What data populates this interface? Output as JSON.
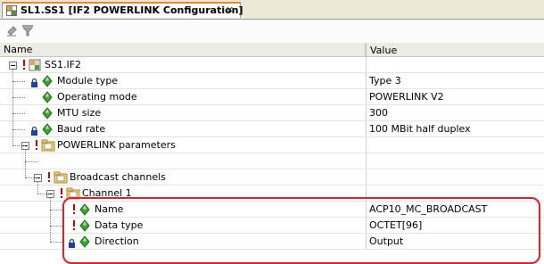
{
  "tab": {
    "title": "SL1.SS1 [IF2 POWERLINK Configuration]",
    "close_glyph": "×",
    "icon": "config-grid-icon"
  },
  "toolbar": {
    "buttons": [
      {
        "name": "edit-tool-button",
        "icon": "eraser-icon"
      },
      {
        "name": "filter-tool-button",
        "icon": "funnel-icon"
      }
    ]
  },
  "grid": {
    "headers": {
      "name": "Name",
      "value": "Value"
    },
    "rows": [
      {
        "label": "SS1.IF2",
        "value": "",
        "icon": "module-folder-icon",
        "expander": "minus",
        "warning": true,
        "lock": false,
        "depth": 0
      },
      {
        "label": "Module type",
        "value": "Type 3",
        "icon": "green-diamond-icon",
        "expander": "",
        "warning": false,
        "lock": true,
        "depth": 1
      },
      {
        "label": "Operating mode",
        "value": "POWERLINK V2",
        "icon": "green-diamond-icon",
        "expander": "",
        "warning": false,
        "lock": false,
        "depth": 1
      },
      {
        "label": "MTU size",
        "value": "300",
        "icon": "green-diamond-icon",
        "expander": "",
        "warning": false,
        "lock": false,
        "depth": 1
      },
      {
        "label": "Baud rate",
        "value": "100 MBit half duplex",
        "icon": "green-diamond-icon",
        "expander": "",
        "warning": false,
        "lock": true,
        "depth": 1
      },
      {
        "label": "POWERLINK parameters",
        "value": "",
        "icon": "folder-icon",
        "expander": "minus",
        "warning": true,
        "lock": false,
        "depth": 1
      },
      {
        "label": "",
        "value": "",
        "icon": "",
        "expander": "",
        "warning": false,
        "lock": false,
        "depth": 2
      },
      {
        "label": "Broadcast channels",
        "value": "",
        "icon": "folder-icon",
        "expander": "minus",
        "warning": true,
        "lock": false,
        "depth": 2
      },
      {
        "label": "Channel 1",
        "value": "",
        "icon": "folder-icon",
        "expander": "minus",
        "warning": true,
        "lock": false,
        "depth": 3
      },
      {
        "label": "Name",
        "value": "ACP10_MC_BROADCAST",
        "icon": "green-diamond-icon",
        "expander": "",
        "warning": true,
        "lock": false,
        "depth": 4
      },
      {
        "label": "Data type",
        "value": "OCTET[96]",
        "icon": "green-diamond-icon",
        "expander": "",
        "warning": true,
        "lock": false,
        "depth": 4
      },
      {
        "label": "Direction",
        "value": "Output",
        "icon": "green-diamond-icon",
        "expander": "",
        "warning": false,
        "lock": true,
        "depth": 4
      }
    ]
  },
  "colors": {
    "warning": "#d00000",
    "diamond": "#3aa62a",
    "folder": "#f2d16b",
    "highlight": "#e0202a",
    "tab_accent": "#e68b2c"
  }
}
